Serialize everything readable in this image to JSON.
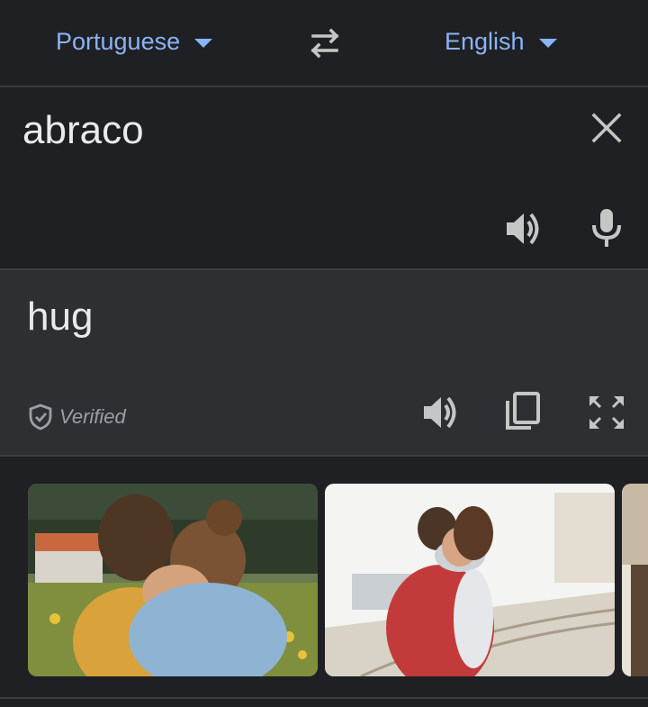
{
  "languages": {
    "source": "Portuguese",
    "target": "English"
  },
  "input": {
    "text": "abraco"
  },
  "output": {
    "text": "hug",
    "verified_label": "Verified"
  },
  "images": [
    {
      "subject": "couple hugging in flower field"
    },
    {
      "subject": "couple hugging at train platform"
    },
    {
      "subject": "partial image"
    }
  ],
  "colors": {
    "accent": "#8ab4f8",
    "background": "#1f2023",
    "output_background": "#2e2f32",
    "text": "#e8eaed",
    "icon": "#c4c7c5"
  }
}
